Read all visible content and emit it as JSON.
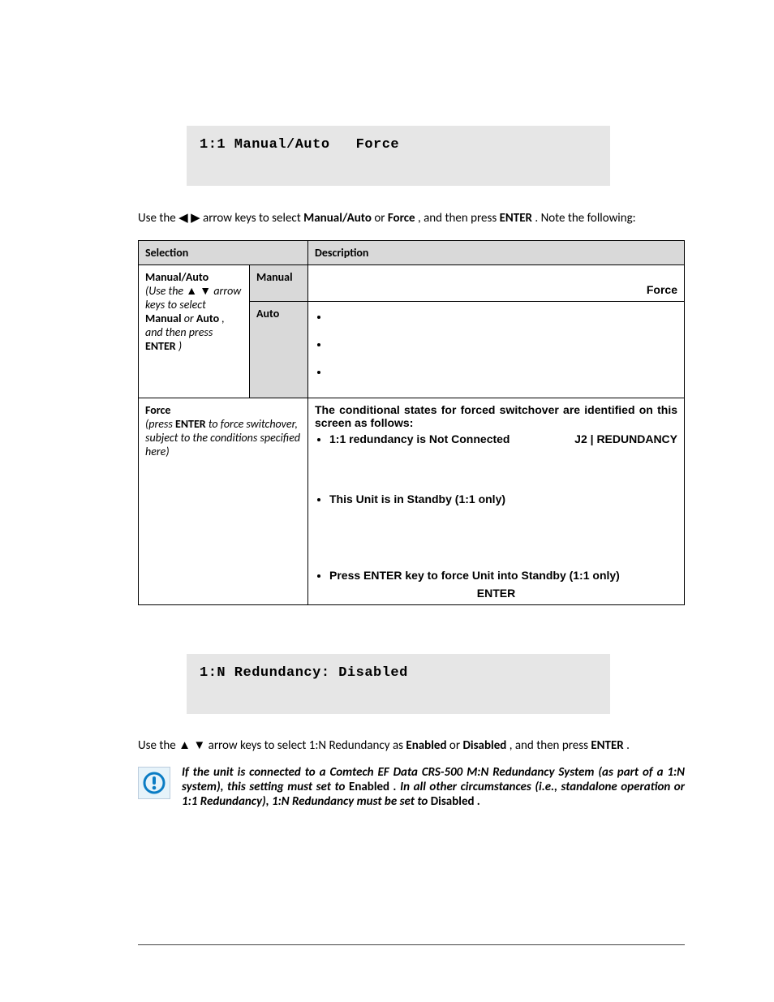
{
  "lcd1": {
    "line1": "1:1 Manual/Auto   Force",
    "line2": " "
  },
  "intro": {
    "prefix": "Use the ",
    "mid1": " arrow keys to select ",
    "opt1": "Manual/Auto",
    "or": " or ",
    "opt2": "Force",
    "mid2": ", and then press ",
    "enter": "ENTER",
    "suffix": ". Note the following:"
  },
  "table": {
    "h_sel": "Selection",
    "h_desc": "Description",
    "row1": {
      "sel_bold1": "Manual/Auto",
      "sel_ital_pre": "(Use the ",
      "sel_ital_mid": " arrow keys to select ",
      "sel_bold2": "Manual",
      "sel_or": " or ",
      "sel_bold3": "Auto",
      "sel_ital_suf": ", and then press ",
      "sel_bold4": "ENTER",
      "sel_close": ")"
    },
    "mode_manual": "Manual",
    "mode_auto": "Auto",
    "manual_force_word": "Force",
    "row_force": {
      "sel_bold": "Force",
      "sel_ital_pre": "(press ",
      "sel_bold2": "ENTER",
      "sel_ital_suf": " to force switchover, subject to the conditions specified here)"
    },
    "force_desc": {
      "lead": "The conditional states for forced switchover are identified on this screen as follows:",
      "b1": "1:1 redundancy is Not Connected",
      "j2": "J2 | REDUNDANCY",
      "b2": "This Unit is in Standby (1:1 only)",
      "b3": "Press ENTER key to force Unit into Standby (1:1 only)",
      "enter_center": "ENTER"
    }
  },
  "lcd2": {
    "line1": "1:N Redundancy: Disabled",
    "line2": " "
  },
  "intro2": {
    "prefix": "Use the ",
    "mid": " arrow keys to select 1:N Redundancy as ",
    "en": "Enabled",
    "or": " or ",
    "dis": "Disabled",
    "suf": ", and then press ",
    "enter": "ENTER",
    "dot": "."
  },
  "note": {
    "t1": "If the unit is connected to a Comtech EF Data CRS-500 M:N Redundancy System (as part of a 1:N system), this setting must set to ",
    "en": "Enabled",
    "t2": ". In all other circumstances (i.e., standalone operation or 1:1 Redundancy), 1:N Redundancy must be set to ",
    "dis": "Disabled",
    "t3": "."
  }
}
